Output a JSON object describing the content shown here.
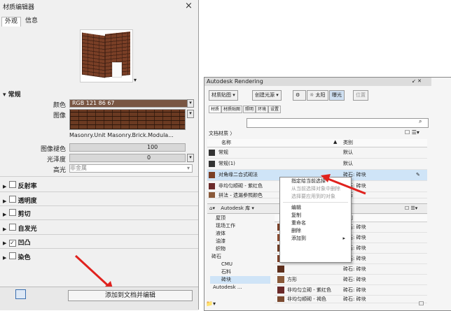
{
  "left_panel": {
    "title": "材质编辑器",
    "close": "×",
    "tabs": [
      "外观",
      "信息"
    ],
    "sections": {
      "general": "常规",
      "color_label": "颜色",
      "color_value": "RGB 121 86 67",
      "image_label": "图像",
      "image_name": "Masonry.Unit Masonry.Brick.Modula...",
      "image_fade_label": "图像褪色",
      "image_fade_value": "100",
      "glossiness_label": "光泽度",
      "glossiness_value": "0",
      "highlights_label": "高光",
      "highlights_value": "非金属"
    },
    "collapsed": [
      {
        "label": "反射率",
        "checked": false
      },
      {
        "label": "透明度",
        "checked": false
      },
      {
        "label": "剪切",
        "checked": false
      },
      {
        "label": "自发光",
        "checked": false
      },
      {
        "label": "凹凸",
        "checked": true
      },
      {
        "label": "染色",
        "checked": false
      }
    ],
    "add_button": "添加到文档并编辑",
    "colors": {
      "swatch": "#795643",
      "brick": "#7a3f26"
    }
  },
  "right_panel": {
    "title": "Autodesk Rendering",
    "title_icons": "↙ ✕",
    "toolbar": [
      "材质贴图 ▾",
      "创建光源 ▾",
      "☼ 太阳",
      "曝光",
      "位置"
    ],
    "tabs": [
      "材质",
      "材质贴图",
      "照明",
      "环境",
      "设置"
    ],
    "breadcrumb": "文档材质",
    "top_table": {
      "headers": [
        "名称",
        "类别"
      ],
      "rows": [
        {
          "name": "常规",
          "cat": "默认",
          "color": "#333333",
          "sel": false
        },
        {
          "name": "常规(1)",
          "cat": "默认",
          "color": "#333333",
          "sel": false
        },
        {
          "name": "对角缘二合式砌法",
          "cat": "砖石: 砖块",
          "color": "#7a3f26",
          "sel": true
        },
        {
          "name": "非均匀顺砌 - 紫红色",
          "cat": "砖石: 砖块",
          "color": "#6b2a2a",
          "sel": false
        },
        {
          "name": "拼法 - 遗漏参照颜色",
          "cat": "砖石",
          "color": "#8a5a3a",
          "sel": false
        }
      ]
    },
    "lib_bar": "Autodesk 库 ▾",
    "tree": [
      "屋顶",
      "现场工作",
      "液体",
      "油漆",
      "织物",
      "砖石",
      "CMU",
      "石料",
      "砖块",
      "Autodesk ..."
    ],
    "bottom_table": {
      "header": "类别",
      "rows": [
        {
          "name": "",
          "cat": "砖石: 砖块"
        },
        {
          "name": "",
          "cat": "砖石: 砖块"
        },
        {
          "name": "",
          "cat": "砖石: 砖块"
        },
        {
          "name": "",
          "cat": "砖石: 砖块"
        },
        {
          "name": "",
          "cat": "砖石: 砖块"
        },
        {
          "name": "方形",
          "cat": "砖石: 砖块"
        },
        {
          "name": "非均匀立砌 - 紫红色",
          "cat": "砖石: 砖块"
        },
        {
          "name": "非均匀顺砌 - 褐色",
          "cat": "砖石: 砖块"
        }
      ]
    },
    "context_menu": {
      "items": [
        "指定给当前选择",
        "从当前选择对象中删除",
        "选择要应用到的对象",
        "编辑",
        "复制",
        "重命名",
        "删除",
        "添加到"
      ],
      "dim": [
        false,
        true,
        true,
        false,
        false,
        false,
        false,
        false
      ]
    }
  }
}
